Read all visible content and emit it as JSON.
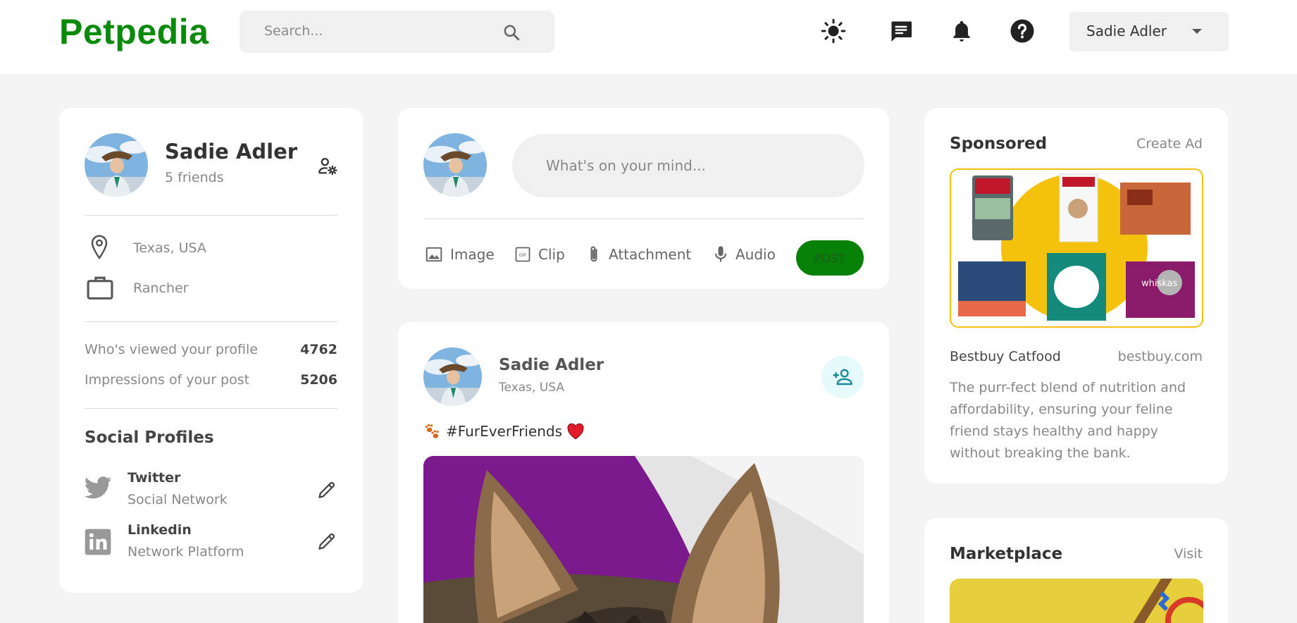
{
  "app": {
    "logo": "Petpedia",
    "brand_color": "#0a8a0a"
  },
  "header": {
    "search_placeholder": "Search...",
    "icons": [
      "sun-icon",
      "message-icon",
      "bell-icon",
      "help-icon"
    ],
    "user_menu": {
      "selected": "Sadie Adler"
    }
  },
  "profile": {
    "name": "Sadie Adler",
    "friends": "5 friends",
    "location": "Texas, USA",
    "occupation": "Rancher",
    "stats": [
      {
        "label": "Who's viewed your profile",
        "value": "4762"
      },
      {
        "label": "Impressions of your post",
        "value": "5206"
      }
    ],
    "social_title": "Social Profiles",
    "socials": [
      {
        "name": "Twitter",
        "type": "Social Network",
        "icon": "twitter-icon"
      },
      {
        "name": "Linkedin",
        "type": "Network Platform",
        "icon": "linkedin-icon"
      }
    ]
  },
  "composer": {
    "placeholder": "What's on your mind...",
    "actions": [
      {
        "label": "Image",
        "icon": "image-icon"
      },
      {
        "label": "Clip",
        "icon": "gif-icon"
      },
      {
        "label": "Attachment",
        "icon": "paperclip-icon"
      },
      {
        "label": "Audio",
        "icon": "microphone-icon"
      }
    ],
    "post_label": "POST"
  },
  "feed": {
    "post": {
      "author": "Sadie Adler",
      "location": "Texas, USA",
      "caption": "#FurEverFriends"
    }
  },
  "sponsored": {
    "title": "Sponsored",
    "link": "Create Ad",
    "product": "Bestbuy Catfood",
    "site": "bestbuy.com",
    "description": "The purr-fect blend of nutrition and affordability, ensuring your feline friend stays healthy and happy without breaking the bank."
  },
  "marketplace": {
    "title": "Marketplace",
    "link": "Visit"
  }
}
